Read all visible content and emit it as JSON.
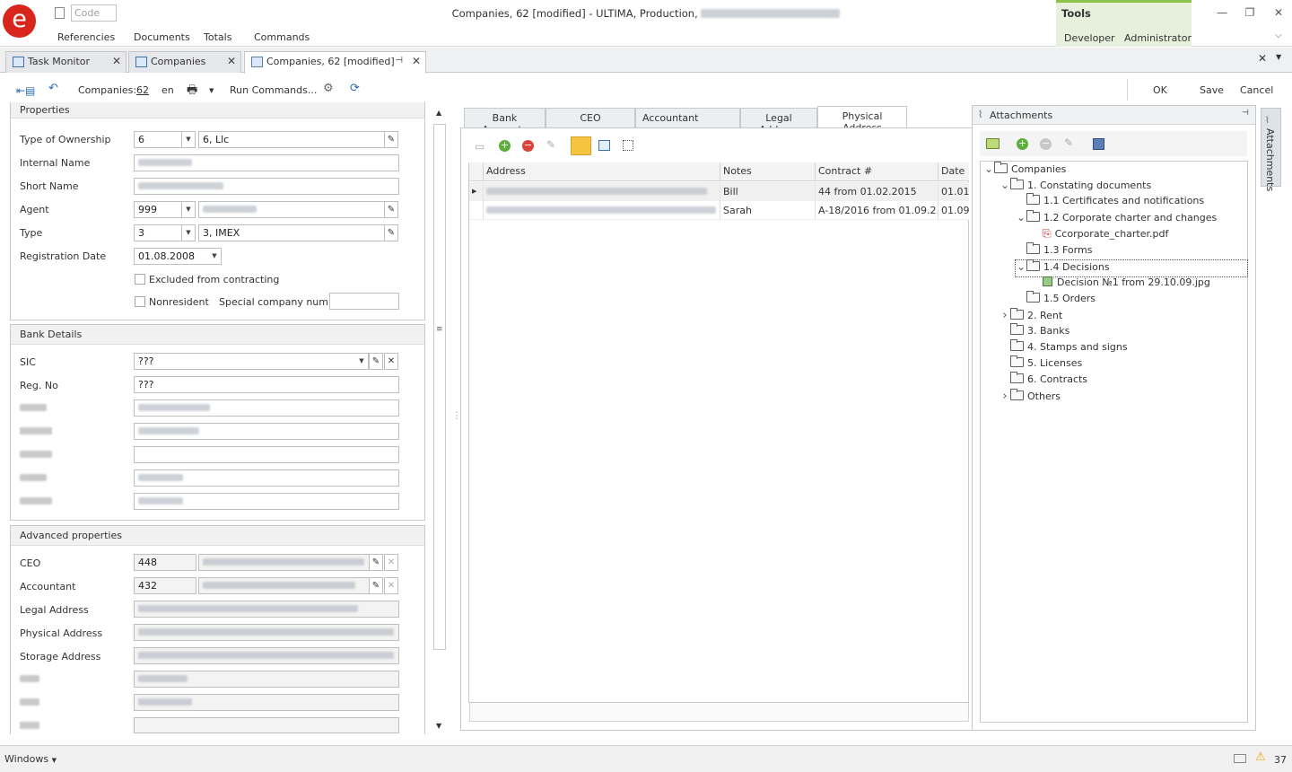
{
  "app": {
    "title": "Companies, 62 [modified] - ULTIMA, Production,",
    "code_placeholder": "Code",
    "logo_letter": "e",
    "menu": [
      "Referencies",
      "Documents",
      "Totals",
      "Commands"
    ],
    "tools": {
      "title": "Tools",
      "items": [
        "Developer",
        "Administrator"
      ]
    }
  },
  "tabs": [
    {
      "label": "Task Monitor"
    },
    {
      "label": "Companies"
    },
    {
      "label": "Companies, 62 [modified]"
    }
  ],
  "toolbar": {
    "entity_label": "Companies:",
    "entity_id": "62",
    "lang": "en",
    "run_commands": "Run Commands...",
    "ok": "OK",
    "save": "Save",
    "cancel": "Cancel"
  },
  "properties": {
    "title": "Properties",
    "type_of_ownership": {
      "label": "Type of Ownership",
      "code": "6",
      "value": "6, Llc"
    },
    "internal_name": {
      "label": "Internal Name"
    },
    "short_name": {
      "label": "Short Name"
    },
    "agent": {
      "label": "Agent",
      "code": "999"
    },
    "type": {
      "label": "Type",
      "code": "3",
      "value": "3, IMEX"
    },
    "registration_date": {
      "label": "Registration Date",
      "value": "01.08.2008"
    },
    "excluded": "Excluded from contracting",
    "nonresident": "Nonresident",
    "special_number": "Special company numb"
  },
  "bank_details": {
    "title": "Bank Details",
    "sic": {
      "label": "SIC",
      "value": "???"
    },
    "reg_no": {
      "label": "Reg. No",
      "value": "???"
    }
  },
  "advanced": {
    "title": "Advanced properties",
    "ceo": {
      "label": "CEO",
      "code": "448"
    },
    "accountant": {
      "label": "Accountant",
      "code": "432"
    },
    "legal_address": {
      "label": "Legal Address"
    },
    "physical_address": {
      "label": "Physical Address"
    },
    "storage_address": {
      "label": "Storage Address"
    }
  },
  "detail_tabs": [
    "Bank Accounts",
    "CEO",
    "Accountant",
    "Legal Address",
    "Physical Address"
  ],
  "grid": {
    "columns": [
      "Address",
      "Notes",
      "Contract #",
      "Date"
    ],
    "rows": [
      {
        "notes": "Bill",
        "contract": "44 from 01.02.2015",
        "date": "01.01."
      },
      {
        "notes": "Sarah",
        "contract": "A-18/2016 from 01.09.2...",
        "date": "01.09."
      }
    ]
  },
  "attachments": {
    "title": "Attachments",
    "side_tab": "Attachments",
    "tree": [
      {
        "label": "Companies",
        "kind": "folder",
        "expand": "v",
        "level": 0
      },
      {
        "label": "1. Constating documents",
        "kind": "folder",
        "expand": "v",
        "level": 1
      },
      {
        "label": "1.1 Certificates and notifications",
        "kind": "folder",
        "expand": "",
        "level": 2
      },
      {
        "label": "1.2 Corporate charter and changes",
        "kind": "folder",
        "expand": "v",
        "level": 2
      },
      {
        "label": "Ccorporate_charter.pdf",
        "kind": "pdf",
        "expand": "",
        "level": 3
      },
      {
        "label": "1.3 Forms",
        "kind": "folder",
        "expand": "",
        "level": 2
      },
      {
        "label": "1.4 Decisions",
        "kind": "folder",
        "expand": "v",
        "level": 2
      },
      {
        "label": "Decision №1 from 29.10.09.jpg",
        "kind": "img",
        "expand": "",
        "level": 3
      },
      {
        "label": "1.5 Orders",
        "kind": "folder",
        "expand": "",
        "level": 2
      },
      {
        "label": "2. Rent",
        "kind": "folder",
        "expand": ">",
        "level": 1
      },
      {
        "label": "3. Banks",
        "kind": "folder",
        "expand": "",
        "level": 1
      },
      {
        "label": "4. Stamps and signs",
        "kind": "folder",
        "expand": "",
        "level": 1
      },
      {
        "label": "5. Licenses",
        "kind": "folder",
        "expand": "",
        "level": 1
      },
      {
        "label": "6. Contracts",
        "kind": "folder",
        "expand": "",
        "level": 1
      },
      {
        "label": "Others",
        "kind": "folder",
        "expand": ">",
        "level": 1
      }
    ]
  },
  "status": {
    "windows": "Windows",
    "count": "37"
  },
  "colors": {
    "accent_green": "#8bc34a",
    "logo_red": "#d9261c",
    "selected_tab": "#f5c542"
  }
}
